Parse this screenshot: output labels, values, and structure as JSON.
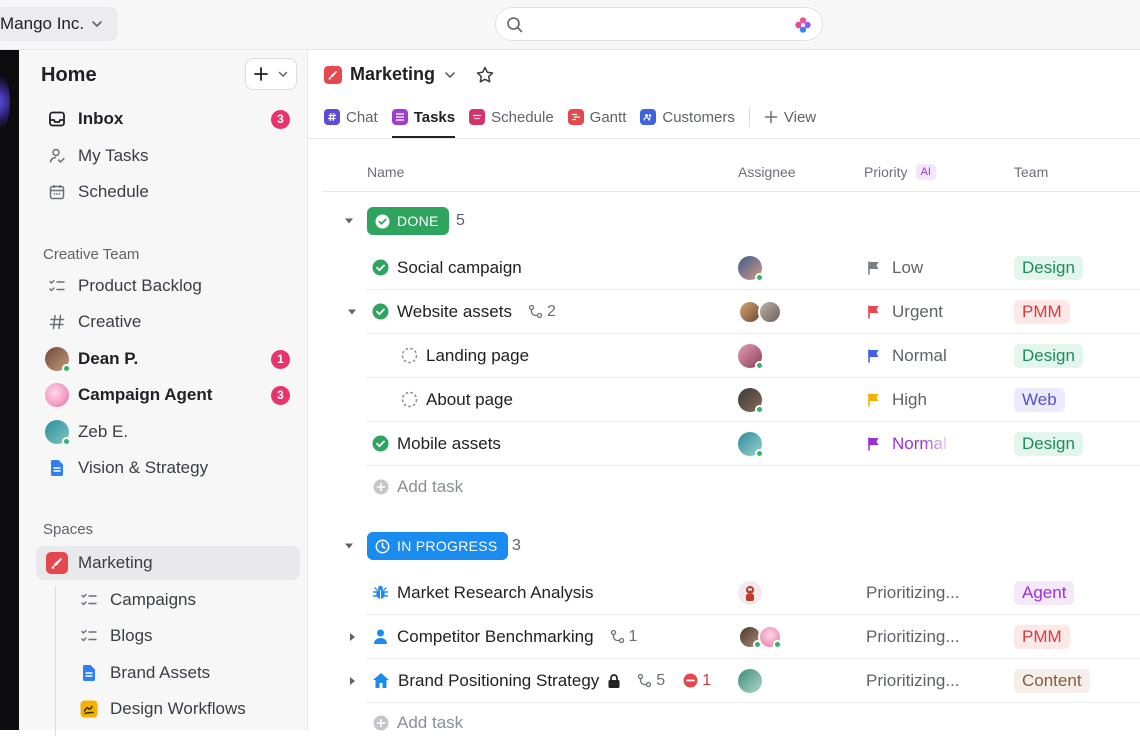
{
  "topbar": {
    "workspace_name": "Mango Inc."
  },
  "sidebar": {
    "home_title": "Home",
    "nav": [
      {
        "label": "Inbox",
        "icon": "inbox-icon",
        "badge": "3"
      },
      {
        "label": "My Tasks",
        "icon": "person-check-icon"
      },
      {
        "label": "Schedule",
        "icon": "calendar-icon"
      }
    ],
    "creative_team_label": "Creative Team",
    "team_items": [
      {
        "label": "Product Backlog",
        "icon": "checklist-icon"
      },
      {
        "label": "Creative",
        "icon": "hash-icon"
      },
      {
        "label": "Dean P.",
        "icon": "avatar",
        "badge": "1"
      },
      {
        "label": "Campaign Agent",
        "icon": "agent-avatar",
        "badge": "3"
      },
      {
        "label": "Zeb E.",
        "icon": "avatar"
      },
      {
        "label": "Vision & Strategy",
        "icon": "doc-icon"
      }
    ],
    "spaces_label": "Spaces",
    "spaces": [
      {
        "label": "Marketing",
        "icon": "marketing-brush-icon"
      },
      {
        "label": "Campaigns",
        "icon": "checklist-icon"
      },
      {
        "label": "Blogs",
        "icon": "checklist-icon"
      },
      {
        "label": "Brand Assets",
        "icon": "doc-icon"
      },
      {
        "label": "Design Workflows",
        "icon": "whiteboard-icon"
      }
    ]
  },
  "main": {
    "title": "Marketing",
    "tabs": [
      {
        "label": "Chat",
        "color": "#5b4bdb"
      },
      {
        "label": "Tasks",
        "color": "#9b3fcf"
      },
      {
        "label": "Schedule",
        "color": "#d6336c"
      },
      {
        "label": "Gantt",
        "color": "#e5484d"
      },
      {
        "label": "Customers",
        "color": "#3e63dd"
      },
      {
        "label": "View"
      }
    ],
    "columns": {
      "name": "Name",
      "assignee": "Assignee",
      "priority": "Priority",
      "priority_badge": "AI",
      "team": "Team"
    },
    "groups": [
      {
        "status": "DONE",
        "color": "#2fa45f",
        "count": "5",
        "tasks": [
          {
            "name": "Social campaign",
            "priority": "Low",
            "priority_color": "#7a7e85",
            "team": "Design"
          },
          {
            "name": "Website assets",
            "subtasks": "2",
            "priority": "Urgent",
            "priority_color": "#e5484d",
            "team": "PMM"
          },
          {
            "name": "Landing page",
            "priority": "Normal",
            "priority_color": "#3e63dd",
            "team": "Design"
          },
          {
            "name": "About page",
            "priority": "High",
            "priority_color": "#f5b000",
            "team": "Web"
          },
          {
            "name": "Mobile assets",
            "priority": "Normal",
            "priority_color": "#9b2fd8",
            "team": "Design"
          }
        ],
        "add_task": "Add task"
      },
      {
        "status": "IN PROGRESS",
        "color": "#1a8cf0",
        "count": "3",
        "tasks": [
          {
            "name": "Market Research Analysis",
            "priority": "Prioritizing...",
            "team": "Agent"
          },
          {
            "name": "Competitor Benchmarking",
            "subtasks": "1",
            "priority": "Prioritizing...",
            "team": "PMM"
          },
          {
            "name": "Brand Positioning Strategy",
            "subtasks": "5",
            "blocked": "1",
            "priority": "Prioritizing...",
            "team": "Content"
          }
        ],
        "add_task": "Add task"
      }
    ]
  },
  "colors": {
    "design_bg": "#e3f6ee",
    "design_fg": "#1f8a5b",
    "pmm_bg": "#fde8e8",
    "pmm_fg": "#d63c3c",
    "web_bg": "#ecebfb",
    "web_fg": "#5a4fcf",
    "agent_bg": "#f6e8fb",
    "agent_fg": "#9b2fd8",
    "content_bg": "#f6efe9",
    "content_fg": "#8a5a3c"
  }
}
